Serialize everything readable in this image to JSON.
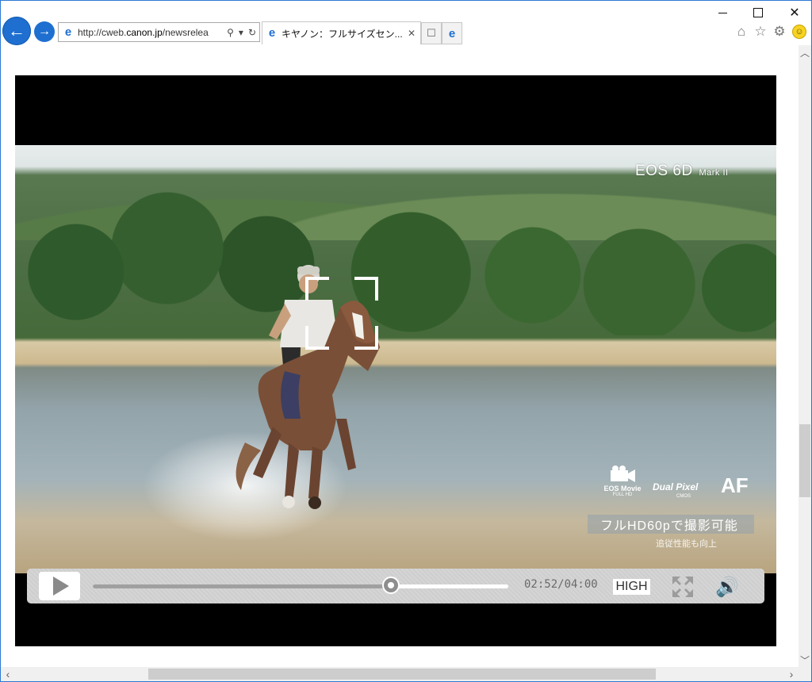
{
  "window": {
    "minimize_glyph": "—",
    "maximize_glyph": "☐",
    "close_glyph": "✕"
  },
  "nav": {
    "back_glyph": "←",
    "forward_glyph": "→"
  },
  "address_bar": {
    "url_prefix": "http://cweb.",
    "url_domain": "canon.jp",
    "url_suffix": "/newsrelea",
    "search_glyph": "⚲",
    "dropdown_glyph": "▾",
    "refresh_glyph": "↻"
  },
  "tabs": [
    {
      "title": "キヤノン：フルサイズセン...",
      "close_glyph": "✕"
    }
  ],
  "toolbar": {
    "new_tab_glyph": "☐",
    "home_glyph": "⌂",
    "favorites_glyph": "☆",
    "settings_glyph": "⚙",
    "feedback_glyph": "☺"
  },
  "video": {
    "brand_title": "EOS 6D",
    "brand_sub": "Mark II",
    "badge_movie_line1": "EOS Movie",
    "badge_movie_line2": "FULL HD",
    "badge_dp_line1": "Dual Pixel",
    "badge_dp_line2": "CMOS",
    "badge_af": "AF",
    "caption_main": "フルHD60pで撮影可能",
    "caption_sub": "追従性能も向上"
  },
  "player_controls": {
    "current_time": "02:52",
    "total_time": "04:00",
    "time_display": "02:52/04:00",
    "progress_fraction": 0.7167,
    "quality_label": "HIGH",
    "volume_glyph": "🔊"
  },
  "scrollbars": {
    "up_glyph": "︿",
    "down_glyph": "﹀",
    "left_glyph": "‹",
    "right_glyph": "›"
  }
}
